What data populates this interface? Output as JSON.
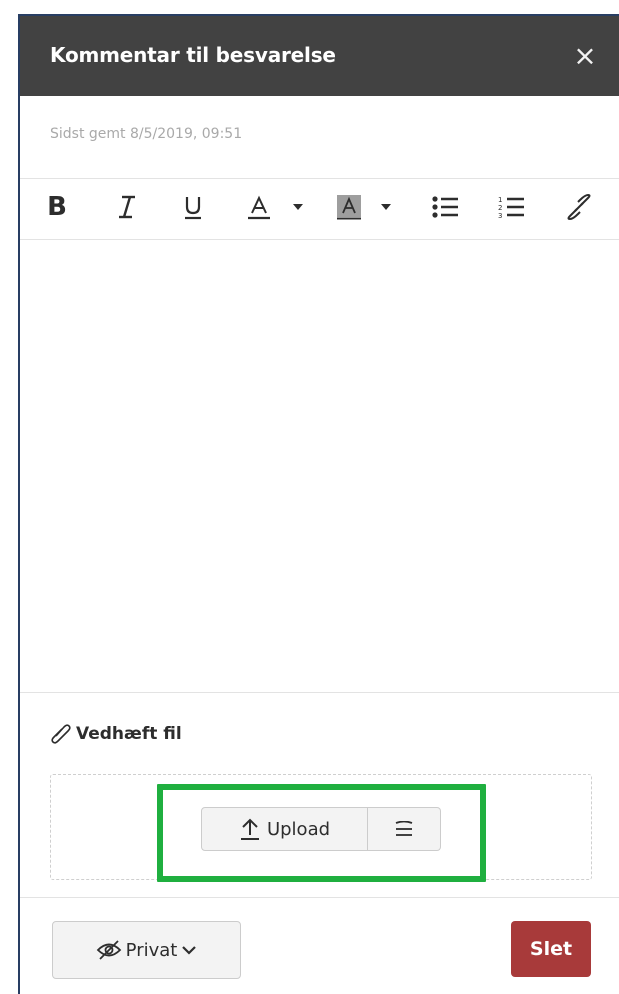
{
  "dialog": {
    "title": "Kommentar til besvarelse",
    "close_symbol": "×",
    "close_icon": "close-icon"
  },
  "status": {
    "saved_text": "Sidst gemt 8/5/2019, 09:51"
  },
  "toolbar": {
    "bold": "B",
    "items": [
      "bold-icon",
      "italic-icon",
      "underline-icon",
      "font-color-icon",
      "caret-down-icon",
      "background-color-icon",
      "caret-down-icon",
      "bullet-list-icon",
      "numbered-list-icon",
      "link-icon"
    ]
  },
  "editor": {
    "content": ""
  },
  "attachment": {
    "label": "Vedhæft fil",
    "upload_label": "Upload",
    "icons": [
      "paperclip-icon",
      "upload-arrow-icon",
      "menu-icon"
    ]
  },
  "footer": {
    "privacy_label": "Privat",
    "delete_label": "Slet",
    "icons": [
      "eye-slash-icon",
      "chevron-down-icon"
    ]
  },
  "colors": {
    "header_bg": "#424242",
    "delete_bg": "#a83a3a",
    "highlight": "#1faf3f",
    "frame": "#283e63"
  }
}
